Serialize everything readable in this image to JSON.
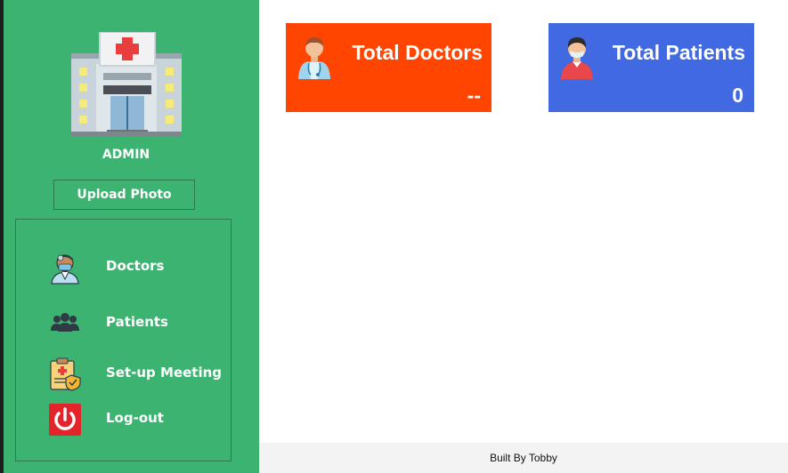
{
  "sidebar": {
    "logo_icon": "hospital-building-icon",
    "user_label": "ADMIN",
    "upload_label": "Upload Photo",
    "nav_items": [
      {
        "label": "Doctors",
        "icon": "doctor-icon"
      },
      {
        "label": "Patients",
        "icon": "patients-group-icon"
      },
      {
        "label": "Set-up Meeting",
        "icon": "clipboard-meeting-icon"
      },
      {
        "label": "Log-out",
        "icon": "power-icon"
      }
    ]
  },
  "cards": [
    {
      "title": "Total Doctors",
      "value": "--",
      "icon": "doctor-icon",
      "color": "#ff4500"
    },
    {
      "title": "Total Patients",
      "value": "0",
      "icon": "patient-icon",
      "color": "#4169e1"
    }
  ],
  "footer": {
    "text": "Built By Tobby"
  },
  "colors": {
    "sidebar": "#3cb371",
    "footer": "#f3f3f3"
  }
}
